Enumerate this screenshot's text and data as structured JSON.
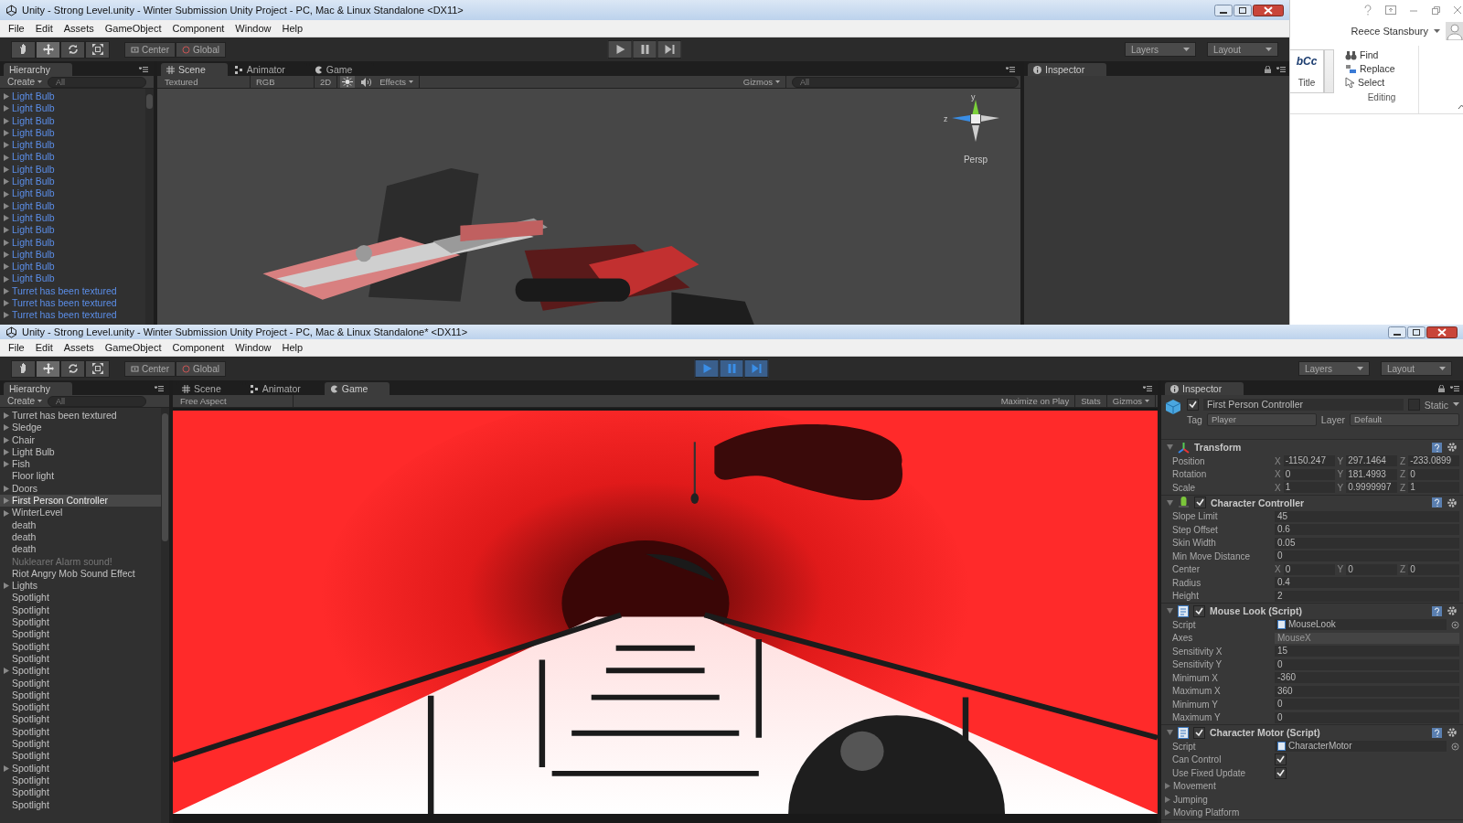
{
  "word": {
    "user": "Reece Stansbury",
    "style_sample": "bCc",
    "style_name": "Title",
    "editing": [
      {
        "kind": "find",
        "label": "Find"
      },
      {
        "kind": "replace",
        "label": "Replace"
      },
      {
        "kind": "select",
        "label": "Select"
      }
    ],
    "group_label": "Editing"
  },
  "top_window": {
    "title": "Unity - Strong Level.unity - Winter Submission Unity Project - PC, Mac & Linux Standalone <DX11>",
    "menu": [
      "File",
      "Edit",
      "Assets",
      "GameObject",
      "Component",
      "Window",
      "Help"
    ],
    "tools": [
      {
        "kind": "hand",
        "selected": false
      },
      {
        "kind": "move",
        "selected": true
      },
      {
        "kind": "rotate",
        "selected": false
      },
      {
        "kind": "scale",
        "selected": false
      }
    ],
    "pivot": "Center",
    "space": "Global",
    "playing": false,
    "layers": "Layers",
    "layout": "Layout",
    "hierarchy": {
      "tab": "Hierarchy",
      "create": "Create",
      "search_placeholder": "All",
      "items": [
        {
          "label": "Light Bulb",
          "expandable": true,
          "prefab": true,
          "selected": false,
          "disabled": false
        },
        {
          "label": "Light Bulb",
          "expandable": true,
          "prefab": true,
          "selected": false,
          "disabled": false
        },
        {
          "label": "Light Bulb",
          "expandable": true,
          "prefab": true,
          "selected": false,
          "disabled": false
        },
        {
          "label": "Light Bulb",
          "expandable": true,
          "prefab": true,
          "selected": false,
          "disabled": false
        },
        {
          "label": "Light Bulb",
          "expandable": true,
          "prefab": true,
          "selected": false,
          "disabled": false
        },
        {
          "label": "Light Bulb",
          "expandable": true,
          "prefab": true,
          "selected": false,
          "disabled": false
        },
        {
          "label": "Light Bulb",
          "expandable": true,
          "prefab": true,
          "selected": false,
          "disabled": false
        },
        {
          "label": "Light Bulb",
          "expandable": true,
          "prefab": true,
          "selected": false,
          "disabled": false
        },
        {
          "label": "Light Bulb",
          "expandable": true,
          "prefab": true,
          "selected": false,
          "disabled": false
        },
        {
          "label": "Light Bulb",
          "expandable": true,
          "prefab": true,
          "selected": false,
          "disabled": false
        },
        {
          "label": "Light Bulb",
          "expandable": true,
          "prefab": true,
          "selected": false,
          "disabled": false
        },
        {
          "label": "Light Bulb",
          "expandable": true,
          "prefab": true,
          "selected": false,
          "disabled": false
        },
        {
          "label": "Light Bulb",
          "expandable": true,
          "prefab": true,
          "selected": false,
          "disabled": false
        },
        {
          "label": "Light Bulb",
          "expandable": true,
          "prefab": true,
          "selected": false,
          "disabled": false
        },
        {
          "label": "Light Bulb",
          "expandable": true,
          "prefab": true,
          "selected": false,
          "disabled": false
        },
        {
          "label": "Light Bulb",
          "expandable": true,
          "prefab": true,
          "selected": false,
          "disabled": false
        },
        {
          "label": "Turret has been textured",
          "expandable": true,
          "prefab": true,
          "selected": false,
          "disabled": false
        },
        {
          "label": "Turret has been textured",
          "expandable": true,
          "prefab": true,
          "selected": false,
          "disabled": false
        },
        {
          "label": "Turret has been textured",
          "expandable": true,
          "prefab": true,
          "selected": false,
          "disabled": false
        }
      ]
    },
    "view_tabs": [
      {
        "kind": "scene",
        "label": "Scene",
        "selected": true
      },
      {
        "kind": "animator",
        "label": "Animator",
        "selected": false
      },
      {
        "kind": "game",
        "label": "Game",
        "selected": false
      }
    ],
    "scene_bar": {
      "shading": "Textured",
      "channel": "RGB",
      "mode": "2D",
      "effects": "Effects",
      "gizmos": "Gizmos",
      "search_placeholder": "All"
    },
    "gizmo": {
      "y_label": "y",
      "z_label": "z",
      "projection": "Persp"
    },
    "inspector_tab": "Inspector"
  },
  "bottom_window": {
    "title": "Unity - Strong Level.unity - Winter Submission Unity Project - PC, Mac & Linux Standalone* <DX11>",
    "menu": [
      "File",
      "Edit",
      "Assets",
      "GameObject",
      "Component",
      "Window",
      "Help"
    ],
    "tools": [
      {
        "kind": "hand",
        "selected": false
      },
      {
        "kind": "move",
        "selected": true
      },
      {
        "kind": "rotate",
        "selected": false
      },
      {
        "kind": "scale",
        "selected": false
      }
    ],
    "pivot": "Center",
    "space": "Global",
    "playing": true,
    "layers": "Layers",
    "layout": "Layout",
    "hierarchy": {
      "tab": "Hierarchy",
      "create": "Create",
      "search_placeholder": "All",
      "items": [
        {
          "label": "Turret has been textured",
          "expandable": true,
          "prefab": false,
          "selected": false,
          "disabled": false
        },
        {
          "label": "Sledge",
          "expandable": true,
          "prefab": false,
          "selected": false,
          "disabled": false
        },
        {
          "label": "Chair",
          "expandable": true,
          "prefab": false,
          "selected": false,
          "disabled": false
        },
        {
          "label": "Light Bulb",
          "expandable": true,
          "prefab": false,
          "selected": false,
          "disabled": false
        },
        {
          "label": "Fish",
          "expandable": true,
          "prefab": false,
          "selected": false,
          "disabled": false
        },
        {
          "label": "Floor light",
          "expandable": false,
          "prefab": false,
          "selected": false,
          "disabled": false
        },
        {
          "label": "Doors",
          "expandable": true,
          "prefab": false,
          "selected": false,
          "disabled": false
        },
        {
          "label": "First Person Controller",
          "expandable": true,
          "prefab": false,
          "selected": true,
          "disabled": false
        },
        {
          "label": "WinterLevel",
          "expandable": true,
          "prefab": false,
          "selected": false,
          "disabled": false
        },
        {
          "label": "death",
          "expandable": false,
          "prefab": false,
          "selected": false,
          "disabled": false
        },
        {
          "label": "death",
          "expandable": false,
          "prefab": false,
          "selected": false,
          "disabled": false
        },
        {
          "label": "death",
          "expandable": false,
          "prefab": false,
          "selected": false,
          "disabled": false
        },
        {
          "label": "Nuklearer Alarm sound!",
          "expandable": false,
          "prefab": false,
          "selected": false,
          "disabled": true
        },
        {
          "label": "Riot Angry Mob Sound Effect",
          "expandable": false,
          "prefab": false,
          "selected": false,
          "disabled": false
        },
        {
          "label": "Lights",
          "expandable": true,
          "prefab": false,
          "selected": false,
          "disabled": false
        },
        {
          "label": "Spotlight",
          "expandable": false,
          "prefab": false,
          "selected": false,
          "disabled": false
        },
        {
          "label": "Spotlight",
          "expandable": false,
          "prefab": false,
          "selected": false,
          "disabled": false
        },
        {
          "label": "Spotlight",
          "expandable": false,
          "prefab": false,
          "selected": false,
          "disabled": false
        },
        {
          "label": "Spotlight",
          "expandable": false,
          "prefab": false,
          "selected": false,
          "disabled": false
        },
        {
          "label": "Spotlight",
          "expandable": false,
          "prefab": false,
          "selected": false,
          "disabled": false
        },
        {
          "label": "Spotlight",
          "expandable": false,
          "prefab": false,
          "selected": false,
          "disabled": false
        },
        {
          "label": "Spotlight",
          "expandable": true,
          "prefab": false,
          "selected": false,
          "disabled": false
        },
        {
          "label": "Spotlight",
          "expandable": false,
          "prefab": false,
          "selected": false,
          "disabled": false
        },
        {
          "label": "Spotlight",
          "expandable": false,
          "prefab": false,
          "selected": false,
          "disabled": false
        },
        {
          "label": "Spotlight",
          "expandable": false,
          "prefab": false,
          "selected": false,
          "disabled": false
        },
        {
          "label": "Spotlight",
          "expandable": false,
          "prefab": false,
          "selected": false,
          "disabled": false
        },
        {
          "label": "Spotlight",
          "expandable": false,
          "prefab": false,
          "selected": false,
          "disabled": false
        },
        {
          "label": "Spotlight",
          "expandable": false,
          "prefab": false,
          "selected": false,
          "disabled": false
        },
        {
          "label": "Spotlight",
          "expandable": false,
          "prefab": false,
          "selected": false,
          "disabled": false
        },
        {
          "label": "Spotlight",
          "expandable": true,
          "prefab": false,
          "selected": false,
          "disabled": false
        },
        {
          "label": "Spotlight",
          "expandable": false,
          "prefab": false,
          "selected": false,
          "disabled": false
        },
        {
          "label": "Spotlight",
          "expandable": false,
          "prefab": false,
          "selected": false,
          "disabled": false
        },
        {
          "label": "Spotlight",
          "expandable": false,
          "prefab": false,
          "selected": false,
          "disabled": false
        }
      ]
    },
    "view_tabs": [
      {
        "kind": "scene",
        "label": "Scene",
        "selected": false
      },
      {
        "kind": "animator",
        "label": "Animator",
        "selected": false
      },
      {
        "kind": "game",
        "label": "Game",
        "selected": true
      }
    ],
    "game_bar": {
      "aspect": "Free Aspect",
      "maximize": "Maximize on Play",
      "stats": "Stats",
      "gizmos": "Gizmos"
    },
    "inspector": {
      "tab": "Inspector",
      "object": {
        "active": true,
        "name": "First Person Controller",
        "static_label": "Static",
        "static": false,
        "tag_label": "Tag",
        "tag": "Player",
        "layer_label": "Layer",
        "layer": "Default"
      },
      "components": [
        {
          "kind": "transform",
          "title": "Transform",
          "rows": [
            {
              "kind": "vector",
              "label": "Position",
              "values": [
                {
                  "axis": "X",
                  "value": "-1150.247"
                },
                {
                  "axis": "Y",
                  "value": "297.1464"
                },
                {
                  "axis": "Z",
                  "value": "-233.0899"
                }
              ]
            },
            {
              "kind": "vector",
              "label": "Rotation",
              "values": [
                {
                  "axis": "X",
                  "value": "0"
                },
                {
                  "axis": "Y",
                  "value": "181.4993"
                },
                {
                  "axis": "Z",
                  "value": "0"
                }
              ]
            },
            {
              "kind": "vector",
              "label": "Scale",
              "values": [
                {
                  "axis": "X",
                  "value": "1"
                },
                {
                  "axis": "Y",
                  "value": "0.9999997"
                },
                {
                  "axis": "Z",
                  "value": "1"
                }
              ]
            }
          ]
        },
        {
          "kind": "controller",
          "title": "Character Controller",
          "enabled": true,
          "rows": [
            {
              "kind": "field",
              "label": "Slope Limit",
              "value": "45"
            },
            {
              "kind": "field",
              "label": "Step Offset",
              "value": "0.6"
            },
            {
              "kind": "field",
              "label": "Skin Width",
              "value": "0.05"
            },
            {
              "kind": "field",
              "label": "Min Move Distance",
              "value": "0"
            },
            {
              "kind": "vector",
              "label": "Center",
              "values": [
                {
                  "axis": "X",
                  "value": "0"
                },
                {
                  "axis": "Y",
                  "value": "0"
                },
                {
                  "axis": "Z",
                  "value": "0"
                }
              ]
            },
            {
              "kind": "field",
              "label": "Radius",
              "value": "0.4"
            },
            {
              "kind": "field",
              "label": "Height",
              "value": "2"
            }
          ]
        },
        {
          "kind": "script",
          "title": "Mouse Look (Script)",
          "enabled": true,
          "rows": [
            {
              "kind": "object",
              "label": "Script",
              "value": "MouseLook"
            },
            {
              "kind": "dropdown",
              "label": "Axes",
              "value": "MouseX"
            },
            {
              "kind": "field",
              "label": "Sensitivity X",
              "value": "15"
            },
            {
              "kind": "field",
              "label": "Sensitivity Y",
              "value": "0"
            },
            {
              "kind": "field",
              "label": "Minimum X",
              "value": "-360"
            },
            {
              "kind": "field",
              "label": "Maximum X",
              "value": "360"
            },
            {
              "kind": "field",
              "label": "Minimum Y",
              "value": "0"
            },
            {
              "kind": "field",
              "label": "Maximum Y",
              "value": "0"
            }
          ]
        },
        {
          "kind": "script",
          "title": "Character Motor (Script)",
          "enabled": true,
          "rows": [
            {
              "kind": "object",
              "label": "Script",
              "value": "CharacterMotor"
            },
            {
              "kind": "checkbox",
              "label": "Can Control",
              "checked": true
            },
            {
              "kind": "checkbox",
              "label": "Use Fixed Update",
              "checked": true
            },
            {
              "kind": "foldout",
              "label": "Movement"
            },
            {
              "kind": "foldout",
              "label": "Jumping"
            },
            {
              "kind": "foldout",
              "label": "Moving Platform"
            }
          ]
        }
      ]
    }
  }
}
